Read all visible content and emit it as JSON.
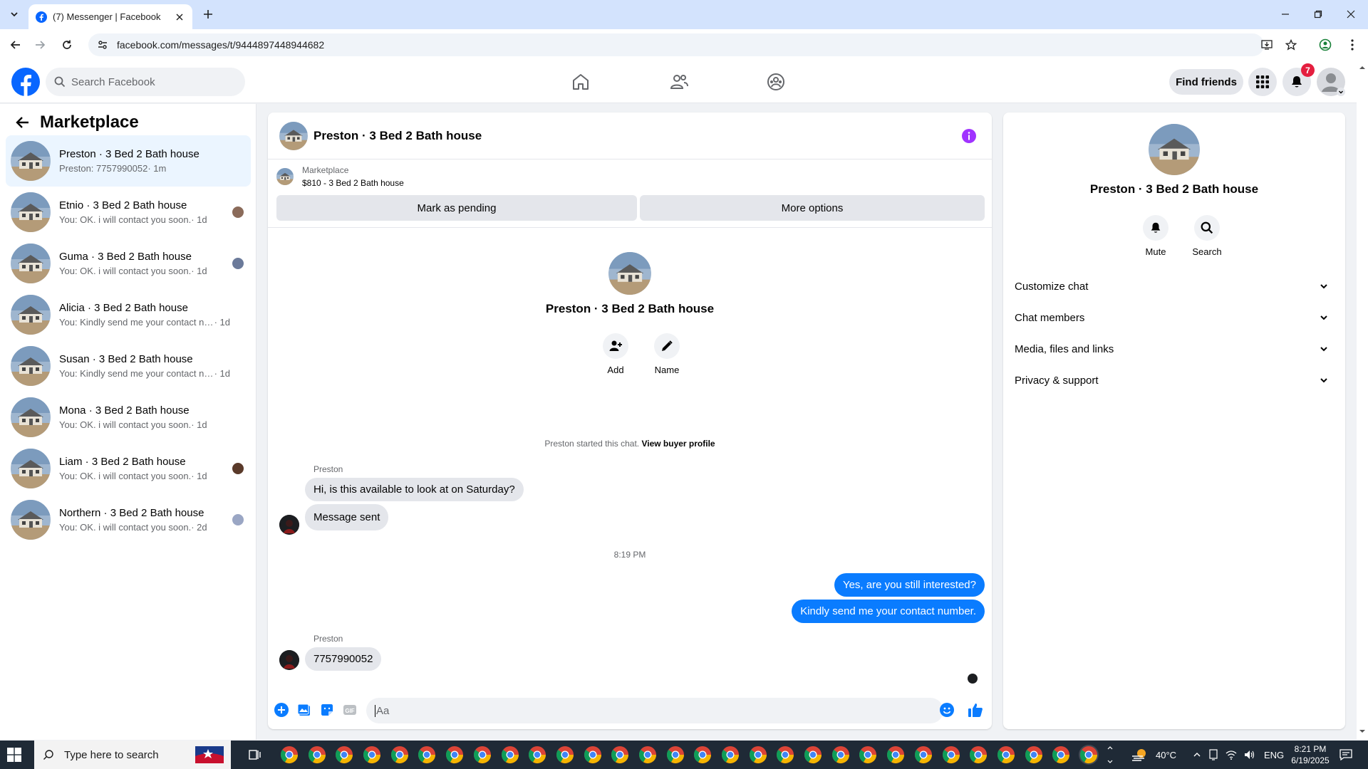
{
  "browser": {
    "tab_title": "(7) Messenger | Facebook",
    "url": "facebook.com/messages/t/9444897448944682"
  },
  "fb": {
    "search_placeholder": "Search Facebook",
    "find_friends": "Find friends",
    "notification_count": "7"
  },
  "left": {
    "title": "Marketplace",
    "conversations": [
      {
        "name": "Preston · 3 Bed 2 Bath house",
        "preview": "Preston: 7757990052",
        "time": " · 1m"
      },
      {
        "name": "Etnio · 3 Bed 2 Bath house",
        "preview": "You: OK. i will contact you soon.",
        "time": " · 1d"
      },
      {
        "name": "Guma · 3 Bed 2 Bath house",
        "preview": "You: OK. i will contact you soon.",
        "time": " · 1d"
      },
      {
        "name": "Alicia · 3 Bed 2 Bath house",
        "preview": "You: Kindly send me your contact nu...",
        "time": " · 1d"
      },
      {
        "name": "Susan · 3 Bed 2 Bath house",
        "preview": "You: Kindly send me your contact nu...",
        "time": " · 1d"
      },
      {
        "name": "Mona · 3 Bed 2 Bath house",
        "preview": "You: OK. i will contact you soon.",
        "time": " · 1d"
      },
      {
        "name": "Liam · 3 Bed 2 Bath house",
        "preview": "You: OK. i will contact you soon.",
        "time": " · 1d"
      },
      {
        "name": "Northern · 3 Bed 2 Bath house",
        "preview": "You: OK. i will contact you soon.",
        "time": " · 2d"
      }
    ]
  },
  "chat": {
    "title": "Preston · 3 Bed 2 Bath house",
    "marketplace_label": "Marketplace",
    "listing": "$810 - 3 Bed 2 Bath house",
    "mark_pending": "Mark as pending",
    "more_options": "More options",
    "intro_name": "Preston · 3 Bed 2 Bath house",
    "add_label": "Add",
    "name_label": "Name",
    "started_text": "Preston started this chat.",
    "view_profile": "View buyer profile",
    "sender_name": "Preston",
    "msg1": "Hi, is this available to look at on Saturday?",
    "msg2": "Message sent",
    "timestamp": "8:19 PM",
    "out1": "Yes, are you still interested?",
    "out2": "Kindly send me your contact number.",
    "sender_name2": "Preston",
    "msg3": "7757990052",
    "composer_placeholder": "Aa"
  },
  "right": {
    "name": "Preston · 3 Bed 2 Bath house",
    "mute": "Mute",
    "search": "Search",
    "sections": [
      "Customize chat",
      "Chat members",
      "Media, files and links",
      "Privacy & support"
    ]
  },
  "taskbar": {
    "search_placeholder": "Type here to search",
    "temperature": "40°C",
    "language": "ENG",
    "time": "8:21 PM",
    "date": "6/19/2025"
  },
  "colors": {
    "fb_blue": "#0866ff",
    "messenger_blue": "#0a7cff",
    "info_purple": "#a033ff"
  }
}
